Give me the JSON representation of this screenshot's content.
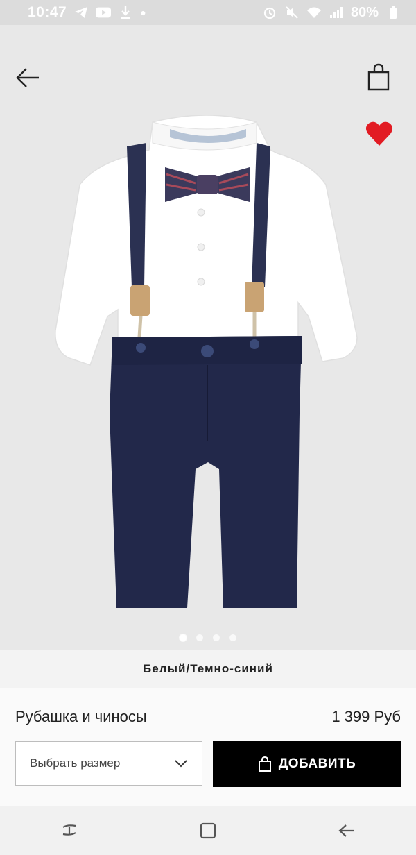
{
  "status_bar": {
    "time": "10:47",
    "battery": "80%",
    "icons": [
      "telegram-icon",
      "youtube-icon",
      "download-icon",
      "notification-dot",
      "alarm-icon",
      "mute-icon",
      "wifi-icon",
      "signal-icon"
    ]
  },
  "header": {
    "back_icon": "back-arrow-icon",
    "bag_icon": "shopping-bag-icon",
    "favorite_icon": "heart-icon"
  },
  "gallery": {
    "image_name": "product-image",
    "dots_total": 4,
    "active_index": 0
  },
  "product": {
    "color": "Белый/Темно-синий",
    "name": "Рубашка и чиносы",
    "price": "1 399 Руб"
  },
  "actions": {
    "size_placeholder": "Выбрать размер",
    "add_label": "ДОБАВИТЬ"
  },
  "nav": {
    "items": [
      "recents-icon",
      "home-icon",
      "back-icon"
    ]
  },
  "colors": {
    "accent_heart": "#e21b23",
    "button_bg": "#000000"
  }
}
